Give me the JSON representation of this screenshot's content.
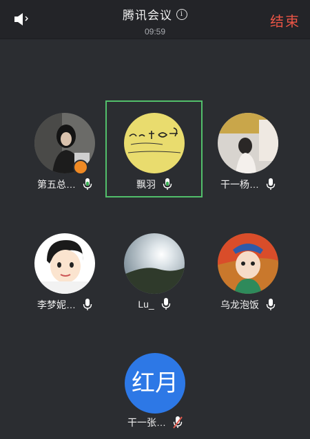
{
  "header": {
    "title": "腾讯会议",
    "time": "09:59",
    "end_label": "结束",
    "info_glyph": "i"
  },
  "participants": [
    {
      "name": "第五总…",
      "mic": "on",
      "host": true
    },
    {
      "name": "飘羽",
      "mic": "on",
      "speaking": true
    },
    {
      "name": "干一杨…",
      "mic": "on"
    },
    {
      "name": "李梦妮…",
      "mic": "on"
    },
    {
      "name": "Lu_",
      "mic": "on"
    },
    {
      "name": "乌龙泡饭",
      "mic": "on"
    }
  ],
  "self": {
    "avatar_text": "红月",
    "name": "干一张…",
    "mic": "muted"
  },
  "colors": {
    "accent_end": "#ea5546",
    "speaking_frame": "#52c06b",
    "mic_on": "#ffffff",
    "mic_muted": "#e05a4f",
    "self_avatar": "#2d78e6"
  }
}
